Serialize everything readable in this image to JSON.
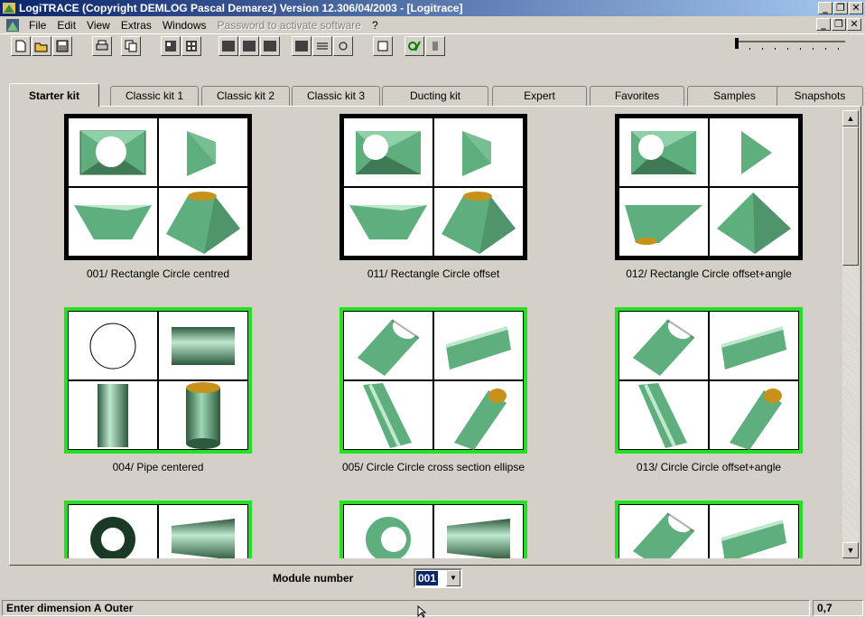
{
  "window": {
    "title": "LogiTRACE (Copyright DEMLOG Pascal Demarez) Version 12.306/04/2003 - [Logitrace]",
    "buttons": [
      "_",
      "❐",
      "✕"
    ]
  },
  "menu": {
    "items": [
      "File",
      "Edit",
      "View",
      "Extras",
      "Windows",
      "Password to activate software",
      "?"
    ],
    "doc_buttons": [
      "_",
      "❐",
      "✕"
    ]
  },
  "tabs": [
    "Starter kit",
    "Classic kit 1",
    "Classic kit 2",
    "Classic kit 3",
    "Ducting kit",
    "Expert",
    "Favorites",
    "Samples",
    "Snapshots"
  ],
  "active_tab": "Starter kit",
  "modules": [
    {
      "label": "001/ Rectangle Circle centred",
      "frame": "black"
    },
    {
      "label": "011/ Rectangle Circle offset",
      "frame": "black"
    },
    {
      "label": "012/ Rectangle Circle offset+angle",
      "frame": "black"
    },
    {
      "label": "004/ Pipe centered",
      "frame": "green"
    },
    {
      "label": "005/ Circle Circle cross section ellipse",
      "frame": "green"
    },
    {
      "label": "013/ Circle Circle offset+angle",
      "frame": "green"
    },
    {
      "label": "",
      "frame": "green"
    },
    {
      "label": "",
      "frame": "green"
    },
    {
      "label": "",
      "frame": "green"
    }
  ],
  "module_number": {
    "label": "Module number",
    "value": "001"
  },
  "status": {
    "message": "Enter dimension A Outer",
    "value": "0,7"
  },
  "colors": {
    "title_start": "#0a246a",
    "title_end": "#a6caf0",
    "green_frame": "#22e022",
    "shape_green": "#5fae7e",
    "shape_inner": "#c8921a"
  }
}
